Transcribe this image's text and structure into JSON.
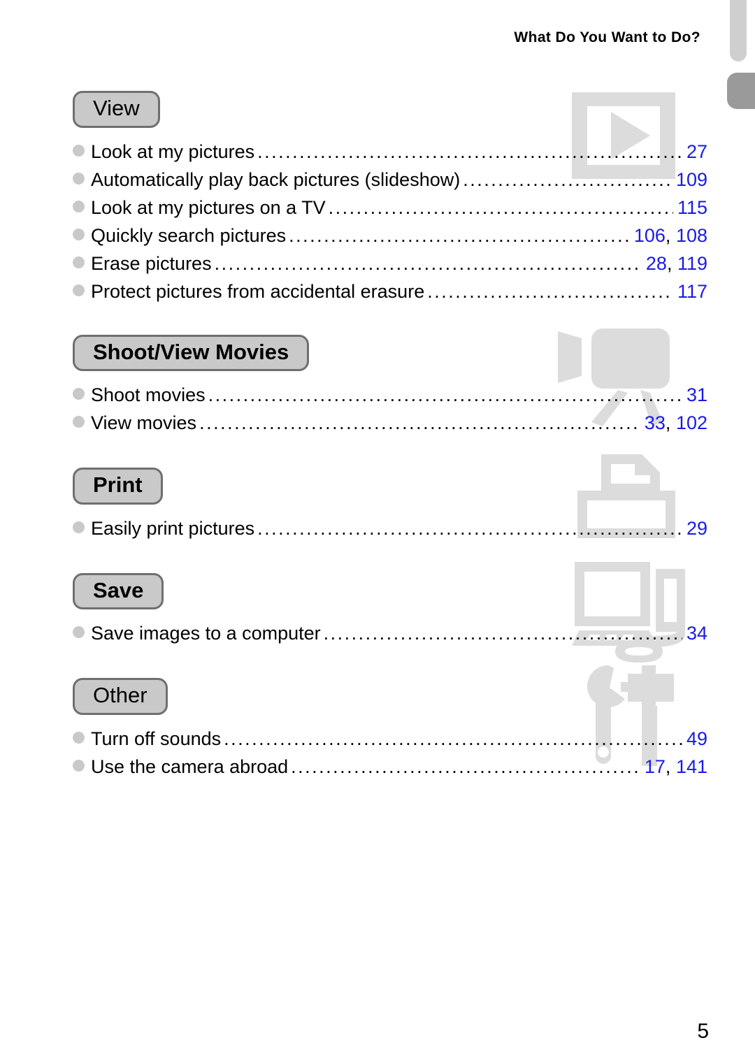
{
  "header": {
    "running_title": "What Do You Want to Do?"
  },
  "folio": {
    "page_number": "5"
  },
  "colors": {
    "page_number_link": "#1a1ae6",
    "badge_fill": "#c9c9c9",
    "badge_border": "#6f6f6f",
    "bullet": "#c9c9c9",
    "watermark": "#dcdcdc",
    "tab_light": "#cfcfcf",
    "tab_dark": "#9a9a9a"
  },
  "tabs": {
    "light_tab_name": "index-tab-light",
    "dark_tab_name": "index-tab-dark"
  },
  "sections": [
    {
      "id": "view",
      "badge": "View",
      "badge_bold": false,
      "icon": "play-screen-icon",
      "entries": [
        {
          "label": "Look at my pictures",
          "pages": "27"
        },
        {
          "label": "Automatically play back pictures (slideshow)",
          "pages": "109"
        },
        {
          "label": "Look at my pictures on a TV",
          "pages": "115"
        },
        {
          "label": "Quickly search pictures",
          "pages": "106, 108"
        },
        {
          "label": "Erase pictures",
          "pages": "28, 119"
        },
        {
          "label": "Protect pictures from accidental erasure",
          "pages": "117"
        }
      ]
    },
    {
      "id": "movies",
      "badge": "Shoot/View Movies",
      "badge_bold": true,
      "icon": "camcorder-icon",
      "entries": [
        {
          "label": "Shoot movies",
          "pages": "31"
        },
        {
          "label": "View movies",
          "pages": "33, 102"
        }
      ]
    },
    {
      "id": "print",
      "badge": "Print",
      "badge_bold": true,
      "icon": "printer-icon",
      "entries": [
        {
          "label": "Easily print pictures",
          "pages": "29"
        }
      ]
    },
    {
      "id": "save",
      "badge": "Save",
      "badge_bold": true,
      "icon": "computer-icon",
      "entries": [
        {
          "label": "Save images to a computer",
          "pages": "34"
        }
      ]
    },
    {
      "id": "other",
      "badge": "Other",
      "badge_bold": false,
      "icon": "wrench-hammer-icon",
      "entries": [
        {
          "label": "Turn off sounds",
          "pages": "49"
        },
        {
          "label": "Use the camera abroad",
          "pages": "17, 141"
        }
      ]
    }
  ]
}
